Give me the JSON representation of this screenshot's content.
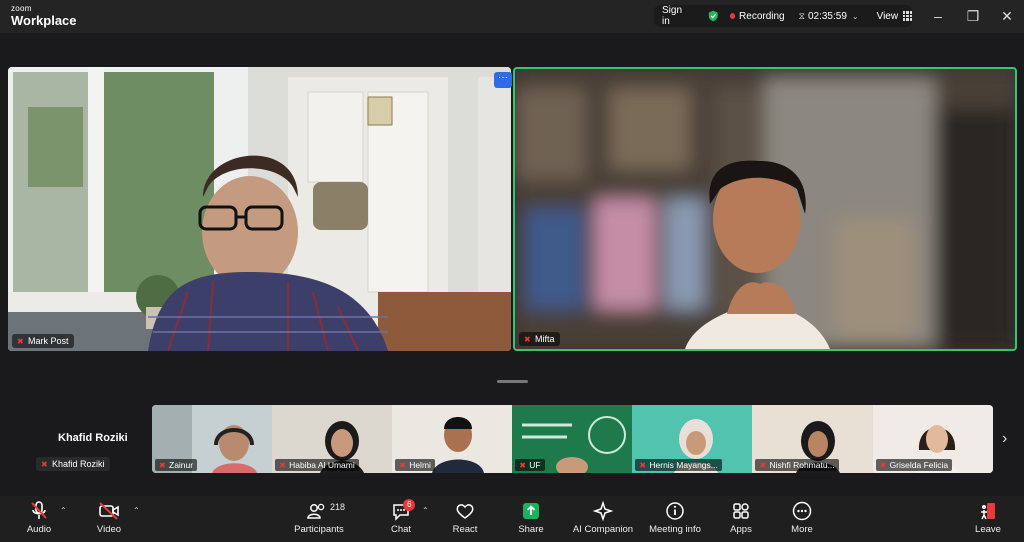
{
  "app": {
    "brand_small": "zoom",
    "brand_large": "Workplace"
  },
  "status": {
    "signin_label": "Sign in",
    "recording_label": "Recording",
    "timer": "02:35:59",
    "view_label": "View"
  },
  "speakers": [
    {
      "name": "Mark Post"
    },
    {
      "name": "Mifta"
    }
  ],
  "self_view": {
    "name": "Khafid Roziki",
    "tag_name": "Khafid Roziki"
  },
  "thumbnails": [
    {
      "name": "Zainur",
      "bg": "#b9c3c6"
    },
    {
      "name": "Habiba Al Umami",
      "bg": "#d8d3ca"
    },
    {
      "name": "Helmi",
      "bg": "#e7e3dd"
    },
    {
      "name": "UF",
      "bg": "#1f7a4d"
    },
    {
      "name": "Hernis Mayangs...",
      "bg": "#4cc4b0"
    },
    {
      "name": "Nishfi Rohmatu...",
      "bg": "#e8ddd0"
    },
    {
      "name": "Griselda Felicia",
      "bg": "#efe8e4"
    }
  ],
  "toolbar": {
    "audio": "Audio",
    "video": "Video",
    "participants": "Participants",
    "participants_count": "218",
    "chat": "Chat",
    "chat_badge": "6",
    "react": "React",
    "share": "Share",
    "ai": "AI Companion",
    "meeting_info": "Meeting info",
    "apps": "Apps",
    "more": "More",
    "leave": "Leave"
  },
  "colors": {
    "accent_green": "#33c76f",
    "record_red": "#e8393b",
    "share_green": "#19b35a"
  }
}
